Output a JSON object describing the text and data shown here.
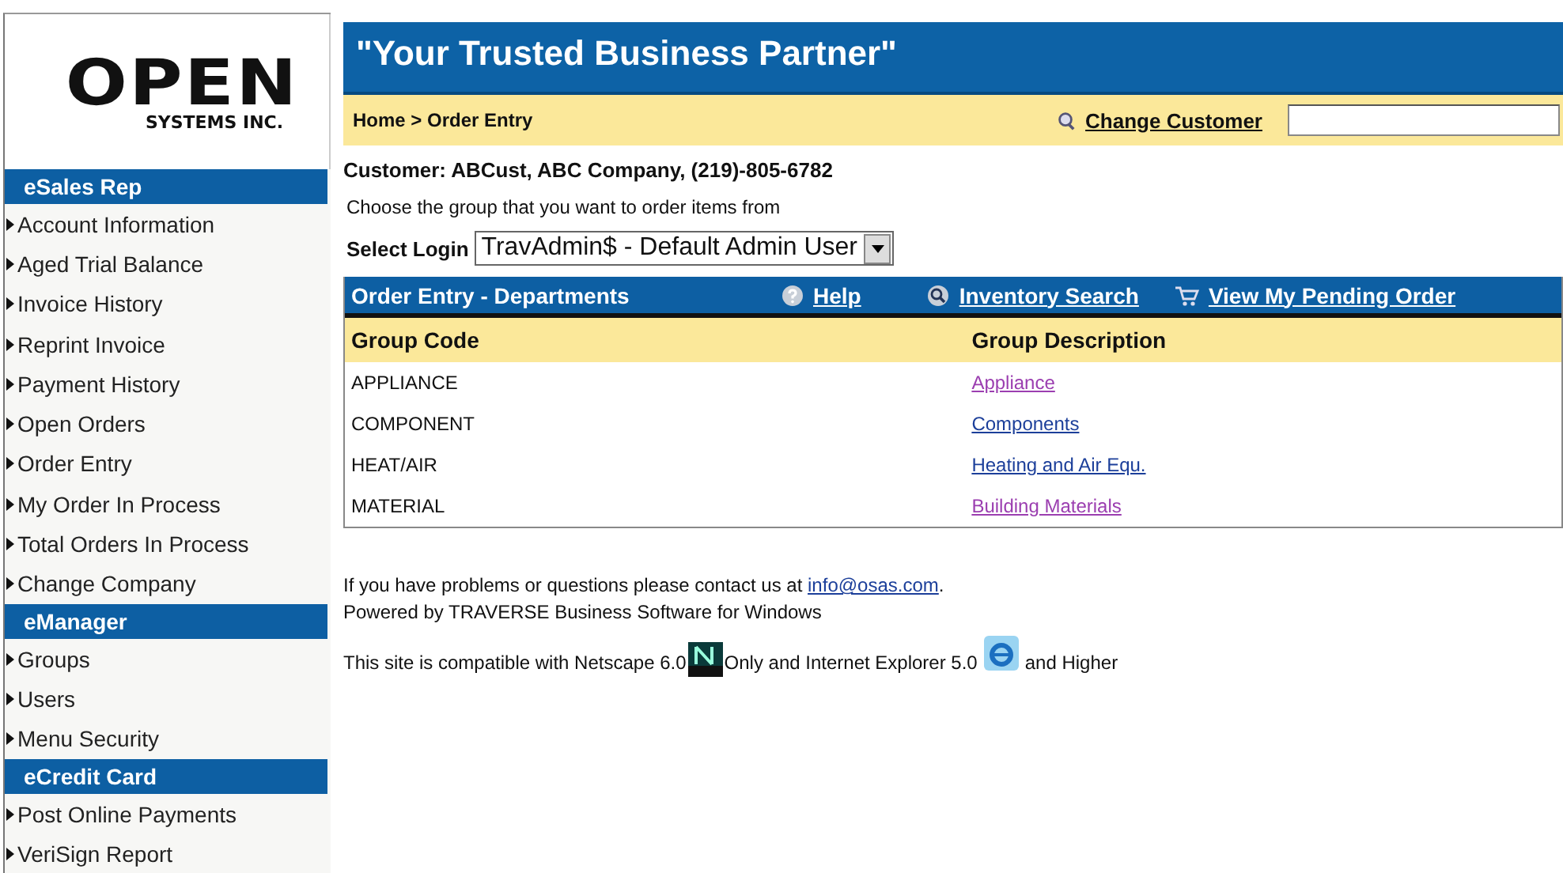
{
  "logo": {
    "wordmark": "OPEN",
    "subtitle": "SYSTEMS INC."
  },
  "banner": {
    "title": "\"Your Trusted Business Partner\""
  },
  "breadcrumb": "Home > Order Entry",
  "change_customer": {
    "label": "Change Customer"
  },
  "sidebar": {
    "sections": [
      {
        "title": "eSales Rep",
        "items": [
          "Account Information",
          "Aged Trial Balance",
          "Invoice History",
          "Reprint Invoice",
          "Payment History",
          "Open Orders",
          "Order Entry",
          "My Order In Process",
          "Total Orders In Process",
          "Change Company"
        ]
      },
      {
        "title": "eManager",
        "items": [
          "Groups",
          "Users",
          "Menu Security"
        ]
      },
      {
        "title": "eCredit Card",
        "items": [
          "Post Online Payments",
          "VeriSign Report"
        ]
      }
    ]
  },
  "customer": "Customer: ABCust, ABC Company, (219)-805-6782",
  "instruction": "Choose the group that you want to order items from",
  "select_login": {
    "label": "Select Login",
    "value": "TravAdmin$ - Default Admin User"
  },
  "departments": {
    "title": "Order Entry - Departments",
    "links": [
      {
        "kind": "help",
        "label": "Help"
      },
      {
        "kind": "search",
        "label": "Inventory Search"
      },
      {
        "kind": "cart",
        "label": "View My Pending Order"
      }
    ],
    "columns": [
      "Group Code",
      "Group Description"
    ],
    "rows": [
      {
        "code": "APPLIANCE",
        "description": "Appliance",
        "visited": true
      },
      {
        "code": "COMPONENT",
        "description": "Components",
        "visited": false
      },
      {
        "code": "HEAT/AIR",
        "description": "Heating and Air Equ.",
        "visited": false
      },
      {
        "code": "MATERIAL",
        "description": "Building Materials",
        "visited": true
      }
    ]
  },
  "footer": {
    "contact_text": "If you have problems or questions please contact us at ",
    "contact_link": "info@osas.com",
    "contact_end": ".",
    "powered": "Powered by TRAVERSE Business Software for Windows",
    "compat": [
      "This site is compatible with Netscape 6.0",
      "Only and Internet Explorer 5.0",
      "and Higher"
    ]
  }
}
